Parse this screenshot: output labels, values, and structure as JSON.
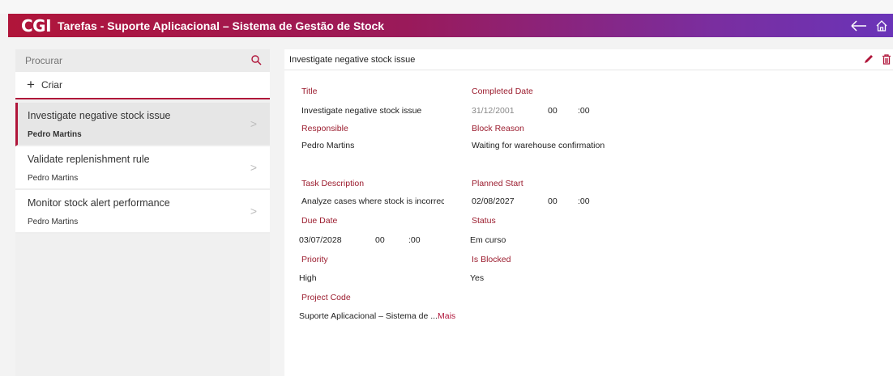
{
  "header": {
    "logo": "CGI",
    "title": "Tarefas - Suporte Aplicacional – Sistema de Gestão de Stock"
  },
  "search": {
    "placeholder": "Procurar"
  },
  "create": {
    "label": "Criar"
  },
  "list": [
    {
      "title": "Investigate negative stock issue",
      "person": "Pedro Martins"
    },
    {
      "title": "Validate replenishment rule",
      "person": "Pedro Martins"
    },
    {
      "title": "Monitor stock alert performance",
      "person": "Pedro Martins"
    }
  ],
  "detail": {
    "header_title": "Investigate negative stock issue",
    "title_label": "Title",
    "title_value": "Investigate negative stock issue",
    "completed_label": "Completed Date",
    "completed_date": "31/12/2001",
    "completed_hour": "00",
    "completed_min": ":00",
    "responsible_label": "Responsible",
    "responsible_value": "Pedro Martins",
    "block_reason_label": "Block Reason",
    "block_reason_value": "Waiting for warehouse confirmation",
    "desc_label": "Task Description",
    "desc_value": "Analyze cases where stock is incorrectly s",
    "planned_label": "Planned Start",
    "planned_date": "02/08/2027",
    "planned_hour": "00",
    "planned_min": ":00",
    "due_label": "Due Date",
    "due_date": "03/07/2028",
    "due_hour": "00",
    "due_min": ":00",
    "status_label": "Status",
    "status_value": "Em curso",
    "priority_label": "Priority",
    "priority_value": "High",
    "blocked_label": "Is Blocked",
    "blocked_value": "Yes",
    "project_label": "Project Code",
    "project_value": "Suporte Aplicacional – Sistema de ...",
    "more_link": "Mais"
  },
  "colors": {
    "accent": "#b0153a",
    "label": "#9b1c2e"
  },
  "icons": [
    "back-arrow-icon",
    "home-icon",
    "search-icon",
    "plus-icon",
    "chevron-right-icon",
    "pencil-icon",
    "trash-icon"
  ]
}
